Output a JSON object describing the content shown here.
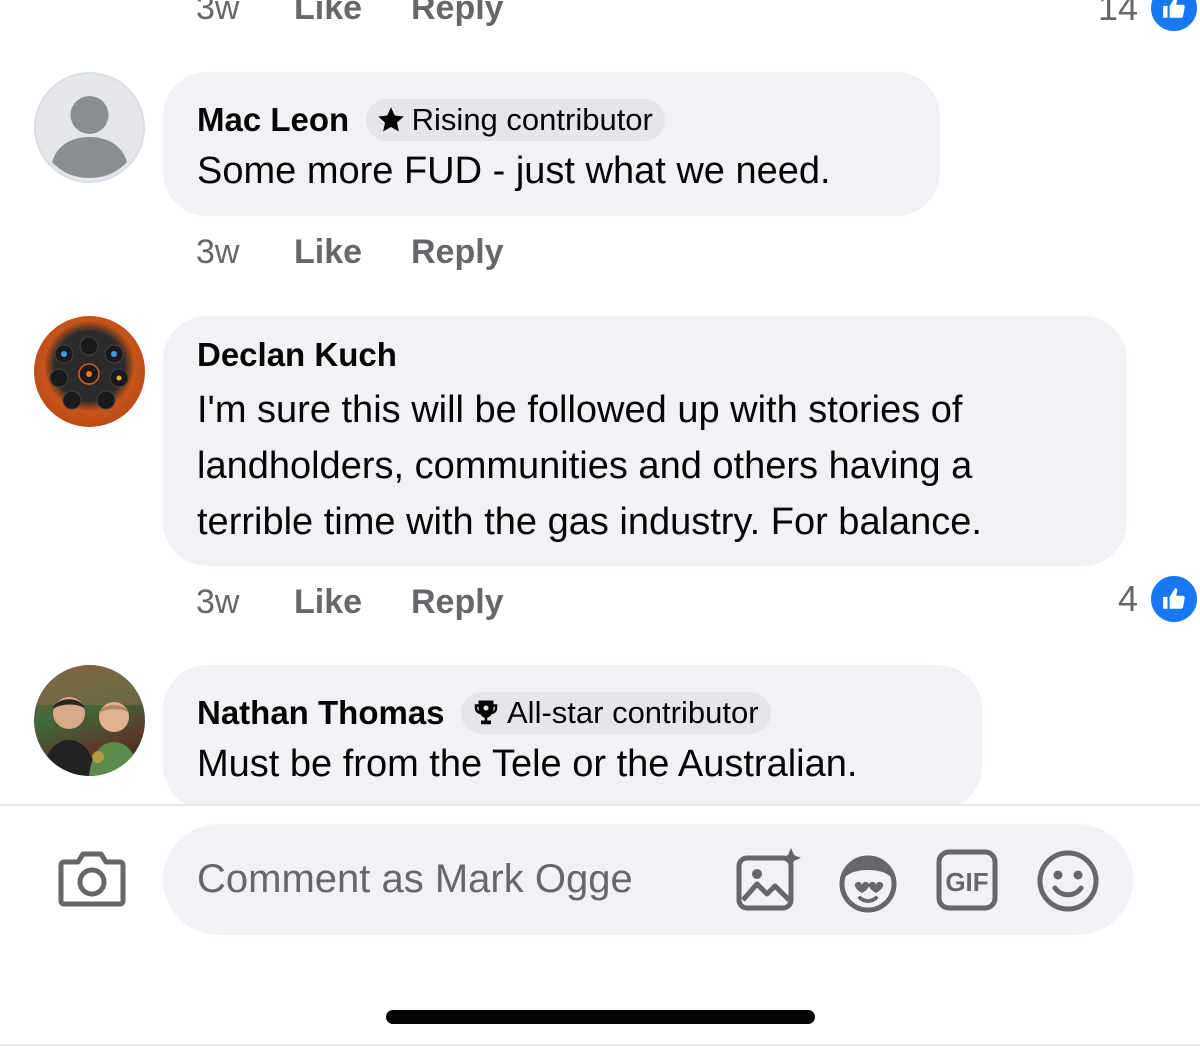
{
  "previous_comment": {
    "time": "3w",
    "like": "Like",
    "reply": "Reply",
    "reactions": "14"
  },
  "comments": [
    {
      "author": "Mac Leon",
      "badge": "Rising contributor",
      "badge_icon": "star-icon",
      "text": [
        "Some more FUD - just what we need."
      ],
      "time": "3w",
      "like": "Like",
      "reply": "Reply"
    },
    {
      "author": "Declan Kuch",
      "text": [
        "I'm sure this will be followed up with stories of",
        "landholders, communities and others having a",
        "terrible time with the gas industry. For balance."
      ],
      "time": "3w",
      "like": "Like",
      "reply": "Reply",
      "reactions": "4"
    },
    {
      "author": "Nathan Thomas",
      "badge": "All-star contributor",
      "badge_icon": "trophy-icon",
      "text": [
        "Must be from the Tele or the Australian."
      ]
    }
  ],
  "composer": {
    "placeholder": "Comment as Mark Ogge",
    "icons": [
      "camera-icon",
      "image-sparkle-icon",
      "avatar-sticker-icon",
      "gif-icon",
      "smiley-icon"
    ],
    "gif_label": "GIF"
  },
  "colors": {
    "accent": "#1877f2",
    "bubble": "#f0f2f5",
    "secondary_text": "#65676b"
  }
}
